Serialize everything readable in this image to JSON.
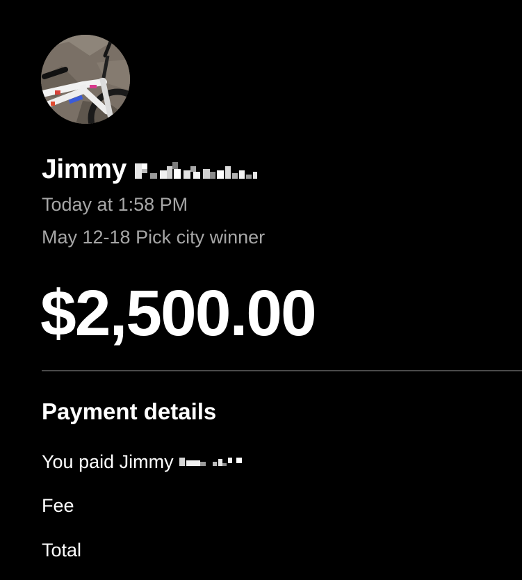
{
  "payment": {
    "payer_first_name": "Jimmy",
    "timestamp": "Today at 1:58 PM",
    "note": "May 12-18 Pick city winner",
    "amount": "$2,500.00"
  },
  "details": {
    "title": "Payment details",
    "paid_label": "You paid Jimmy",
    "fee_label": "Fee",
    "total_label": "Total"
  },
  "icons": {
    "avatar": "bmx-bike-photo-avatar",
    "redaction": "pixelated-redaction"
  },
  "colors": {
    "background": "#000000",
    "primary_text": "#ffffff",
    "secondary_text": "#a6a6a6",
    "divider": "#4a4a4a"
  }
}
